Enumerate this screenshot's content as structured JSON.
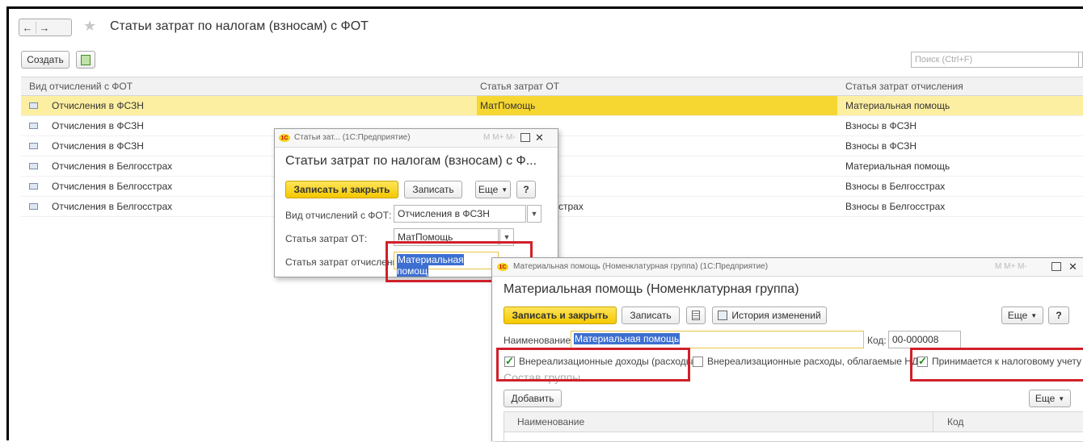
{
  "main": {
    "title": "Статьи затрат по налогам (взносам) с ФОТ",
    "create_label": "Создать",
    "search_placeholder": "Поиск (Ctrl+F)",
    "columns": [
      "Вид отчислений с ФОТ",
      "Статья затрат ОТ",
      "Статья затрат отчисления"
    ],
    "rows": [
      {
        "kind": "Отчисления в ФСЗН",
        "cost_ot": "МатПомощь",
        "cost_ded": "Материальная помощь",
        "selected": true
      },
      {
        "kind": "Отчисления в ФСЗН",
        "cost_ot": "",
        "cost_ded": "Взносы в ФСЗН"
      },
      {
        "kind": "Отчисления в ФСЗН",
        "cost_ot": "",
        "cost_ded": "Взносы в ФСЗН"
      },
      {
        "kind": "Отчисления в Белгосстрах",
        "cost_ot": "",
        "cost_ded": "Материальная помощь"
      },
      {
        "kind": "Отчисления в Белгосстрах",
        "cost_ot": "",
        "cost_ded": "Взносы в Белгосстрах"
      },
      {
        "kind": "Отчисления в Белгосстрах",
        "cost_ot": "сстрах",
        "cost_ded": "Взносы в Белгосстрах"
      }
    ]
  },
  "dialog1": {
    "window_title": "Статьи зат... (1С:Предприятие)",
    "window_controls": "M  M+  M-",
    "logo": "1С",
    "heading": "Статьи затрат по налогам (взносам) с Ф...",
    "save_close": "Записать и закрыть",
    "save": "Записать",
    "more": "Еще",
    "help": "?",
    "label_kind": "Вид отчислений с ФОТ:",
    "value_kind": "Отчисления в ФСЗН",
    "label_cost_ot": "Статья затрат ОТ:",
    "value_cost_ot": "МатПомощь",
    "label_cost_ded": "Статья затрат отчисления:",
    "value_cost_ded": "Материальная помощ"
  },
  "dialog2": {
    "window_title": "Материальная помощь (Номенклатурная группа) (1С:Предприятие)",
    "window_controls": "M  M+  M-",
    "logo": "1С",
    "heading": "Материальная помощь (Номенклатурная группа)",
    "save_close": "Записать и закрыть",
    "save": "Записать",
    "history": "История изменений",
    "more": "Еще",
    "help": "?",
    "label_name": "Наименование:",
    "value_name": "Материальная помощь",
    "label_code": "Код:",
    "value_code": "00-000008",
    "chk1_label": "Внереализационные доходы (расходы)",
    "chk1_checked": true,
    "chk2_label": "Внереализационные расходы, облагаемые НДС",
    "chk2_checked": false,
    "chk3_label": "Принимается к налоговому учету",
    "chk3_checked": true,
    "group_title": "Состав группы",
    "add_label": "Добавить",
    "more2": "Еще",
    "col_name": "Наименование",
    "col_code": "Код"
  },
  "colors": {
    "accent_yellow": "#f6d731",
    "highlight_red": "#d0202a",
    "selected_row": "#fcefa1"
  }
}
